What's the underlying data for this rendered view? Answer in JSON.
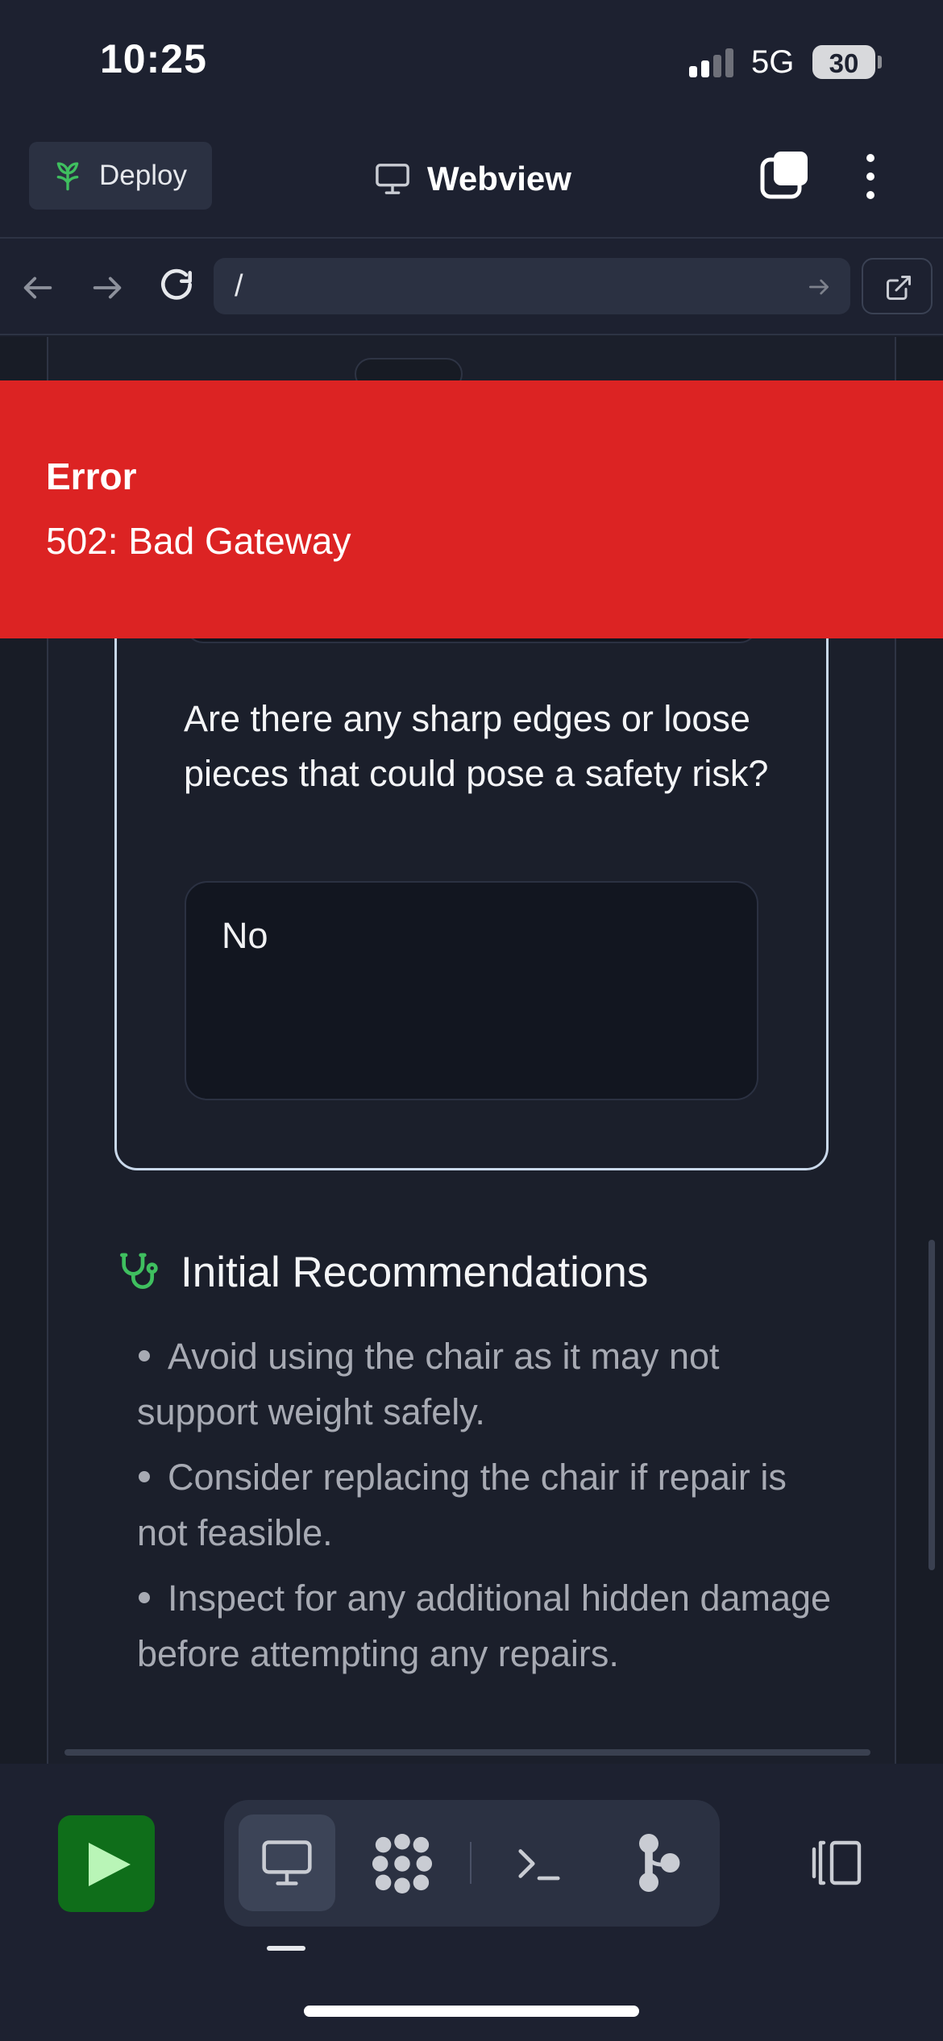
{
  "status_bar": {
    "time": "10:25",
    "network": "5G",
    "battery": "30"
  },
  "header": {
    "deploy_label": "Deploy",
    "title": "Webview",
    "icons": [
      "deploy-icon",
      "monitor-icon",
      "tabs-icon",
      "more-vertical-icon"
    ]
  },
  "url_bar": {
    "url": "/",
    "icons": [
      "arrow-left-icon",
      "arrow-right-icon",
      "reload-icon",
      "go-arrow-icon",
      "external-link-icon"
    ]
  },
  "error": {
    "title": "Error",
    "message": "502: Bad Gateway",
    "color": "#dc2323"
  },
  "question": {
    "text": "Are there any sharp edges or loose pieces that could pose a safety risk?",
    "answer": "No"
  },
  "recommendations": {
    "title": "Initial Recommendations",
    "icon": "stethoscope-icon",
    "accent_color": "#3fbf5f",
    "items": [
      "Avoid using the chair as it may not support weight safely.",
      "Consider replacing the chair if repair is not feasible.",
      "Inspect for any additional hidden damage before attempting any repairs."
    ]
  },
  "toolbar": {
    "run_color": "#0f6e1a",
    "tools": [
      "play-icon",
      "monitor-icon",
      "grid-dots-icon",
      "terminal-icon",
      "git-branch-icon",
      "panel-toggle-icon"
    ]
  }
}
